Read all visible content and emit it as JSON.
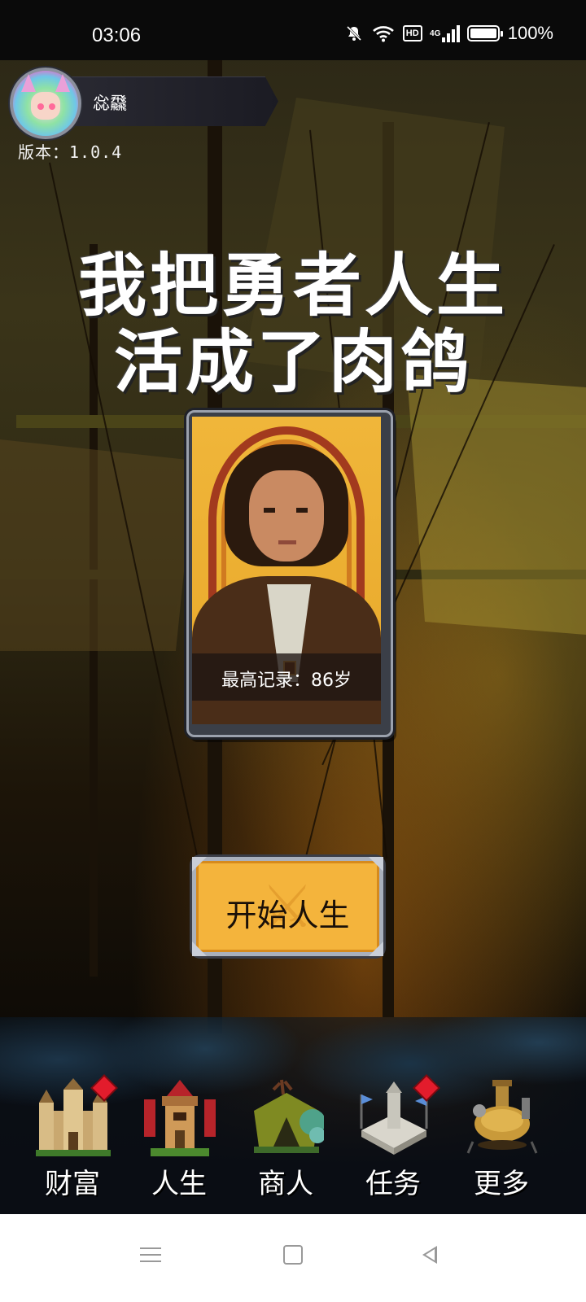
{
  "status_bar": {
    "time": "03:06",
    "battery": "100%",
    "network": "4G",
    "hd": "HD",
    "icons": [
      "mute-icon",
      "wifi-icon",
      "hd-icon",
      "signal-icon",
      "battery-icon"
    ]
  },
  "profile": {
    "username": "惢飝",
    "version": "版本：1.0.4"
  },
  "title": {
    "line1": "我把勇者人生",
    "line2": "活成了肉鸽"
  },
  "card": {
    "record": "最高记录：86岁"
  },
  "start_button": {
    "label": "开始人生"
  },
  "nav": {
    "items": [
      {
        "label": "财富",
        "icon": "castle-icon",
        "badge": true
      },
      {
        "label": "人生",
        "icon": "tower-icon",
        "badge": false
      },
      {
        "label": "商人",
        "icon": "merchant-tent-icon",
        "badge": false
      },
      {
        "label": "任务",
        "icon": "quest-altar-icon",
        "badge": true
      },
      {
        "label": "更多",
        "icon": "workshop-icon",
        "badge": false
      }
    ]
  },
  "colors": {
    "accent": "#f4b43c",
    "badge": "#e31c2c",
    "frame": "#9ba1ad"
  }
}
